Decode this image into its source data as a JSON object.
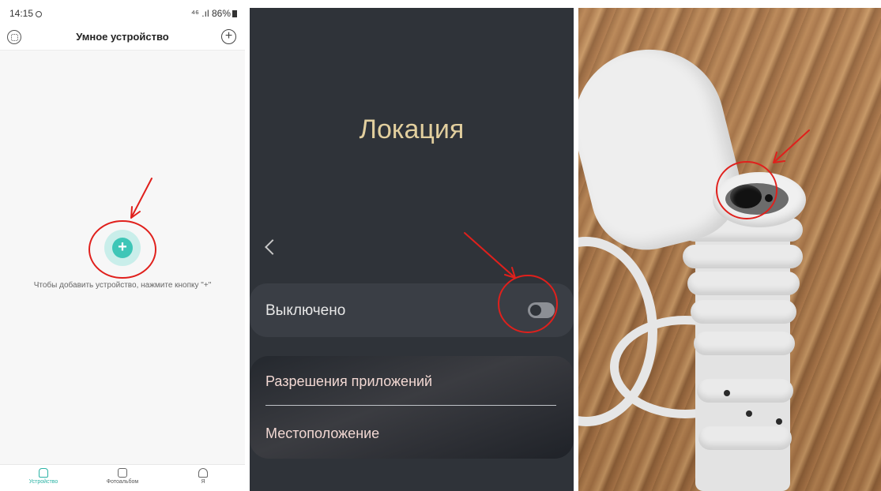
{
  "app_screen": {
    "status_bar": {
      "time": "14:15",
      "right_text": "⁴⁶ .ıl 86%"
    },
    "header": {
      "title": "Умное устройство"
    },
    "empty_state_text": "Чтобы добавить устройство, нажмите кнопку \"+\"",
    "add_button_symbol": "+",
    "tabs": [
      {
        "label": "Устройство",
        "icon": "home-icon",
        "active": true
      },
      {
        "label": "Фотоальбом",
        "icon": "photo-album-icon",
        "active": false
      },
      {
        "label": "Я",
        "icon": "person-icon",
        "active": false
      }
    ],
    "accent_color": "#3ec6b7"
  },
  "location_screen": {
    "title": "Локация",
    "toggle_row": {
      "label": "Выключено",
      "state": "off"
    },
    "menu": [
      {
        "label": "Разрешения приложений"
      },
      {
        "label": "Местоположение"
      }
    ],
    "title_color": "#e2cf9e"
  },
  "photo": {
    "description_icon": "device-reset-button-photo"
  },
  "annotation_color": "#e0201c"
}
